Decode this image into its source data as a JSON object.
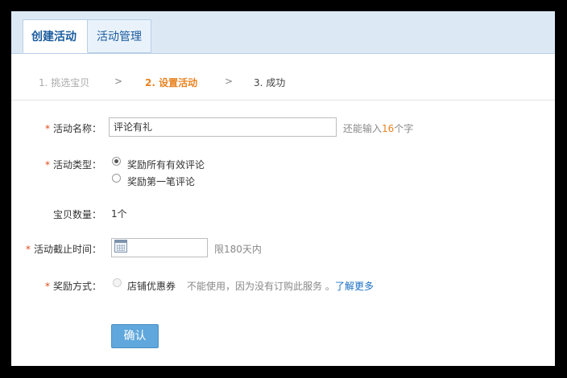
{
  "tabs": [
    {
      "label": "创建活动",
      "active": true
    },
    {
      "label": "活动管理",
      "active": false
    }
  ],
  "steps": {
    "step1": "1. 挑选宝贝",
    "sep": ">",
    "step2": "2. 设置活动",
    "step3": "3. 成功"
  },
  "form": {
    "name": {
      "label": "活动名称：",
      "required": "*",
      "value": "评论有礼",
      "hint_prefix": "还能输入",
      "hint_count": "16",
      "hint_suffix": "个字"
    },
    "type": {
      "label": "活动类型：",
      "required": "*",
      "options": [
        {
          "label": "奖励所有有效评论",
          "selected": true
        },
        {
          "label": "奖励第一笔评论",
          "selected": false
        }
      ]
    },
    "quantity": {
      "label": "宝贝数量：",
      "value": "1个"
    },
    "deadline": {
      "label": "活动截止时间：",
      "required": "*",
      "value": "",
      "hint": "限180天内"
    },
    "reward": {
      "label": "奖励方式：",
      "required": "*",
      "option": "店铺优惠券",
      "note": "不能使用，因为没有订购此服务 。",
      "link": "了解更多"
    }
  },
  "submit_label": "确认",
  "colors": {
    "tab_bar": "#dce9f5",
    "current_step": "#e8821f",
    "button": "#5fa7dc",
    "link": "#1a6fc4",
    "required": "#e04d1c"
  }
}
